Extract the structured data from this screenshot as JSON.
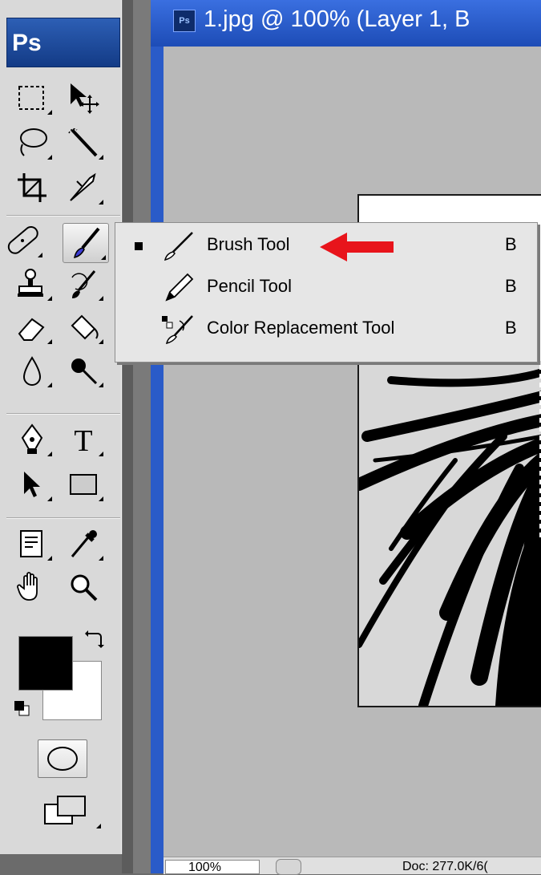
{
  "app": {
    "badge": "Ps"
  },
  "document": {
    "icon_text": "Ps",
    "title": "1.jpg @ 100% (Layer 1, B",
    "zoom": "100%",
    "doc_info": "Doc: 277.0K/6("
  },
  "toolbox": {
    "tools": [
      {
        "name": "rectangular-marquee-tool"
      },
      {
        "name": "move-tool"
      },
      {
        "name": "lasso-tool"
      },
      {
        "name": "quick-selection-tool"
      },
      {
        "name": "crop-tool"
      },
      {
        "name": "slice-tool"
      },
      {
        "name": "spot-healing-brush-tool"
      },
      {
        "name": "brush-tool",
        "selected": true
      },
      {
        "name": "clone-stamp-tool"
      },
      {
        "name": "history-brush-tool"
      },
      {
        "name": "eraser-tool"
      },
      {
        "name": "paint-bucket-tool"
      },
      {
        "name": "blur-tool"
      },
      {
        "name": "dodge-tool"
      },
      {
        "name": "pen-tool"
      },
      {
        "name": "type-tool"
      },
      {
        "name": "path-selection-tool"
      },
      {
        "name": "rectangle-tool"
      },
      {
        "name": "notes-tool"
      },
      {
        "name": "eyedropper-tool"
      },
      {
        "name": "hand-tool"
      },
      {
        "name": "zoom-tool"
      }
    ],
    "foreground_color": "#000000",
    "background_color": "#ffffff"
  },
  "flyout": {
    "items": [
      {
        "label": "Brush Tool",
        "shortcut": "B",
        "checked": true,
        "icon": "brush-icon"
      },
      {
        "label": "Pencil Tool",
        "shortcut": "B",
        "checked": false,
        "icon": "pencil-icon"
      },
      {
        "label": "Color Replacement Tool",
        "shortcut": "B",
        "checked": false,
        "icon": "color-replacement-icon"
      }
    ],
    "annotation_color": "#e8141b"
  }
}
